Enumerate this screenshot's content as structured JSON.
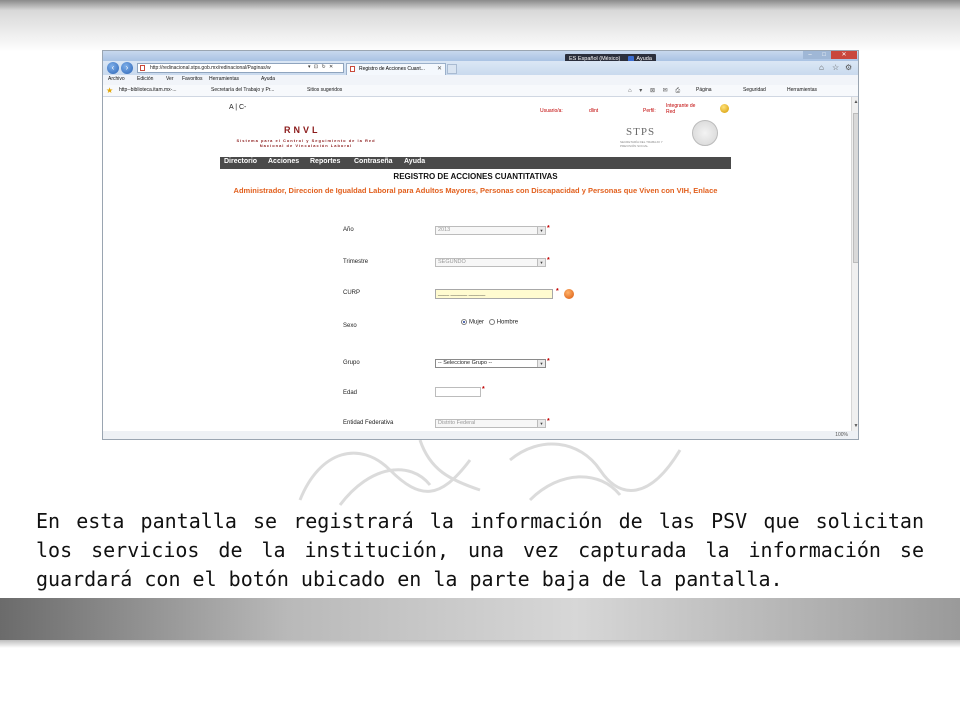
{
  "browser": {
    "url": "http://redinacional.stps.gob.mx/redinacional/Paginas/w",
    "tab_title": "Registro de Acciones Cuant...",
    "language_indicator": "ES Español (México)",
    "help_label": "Ayuda",
    "menu": [
      "Archivo",
      "Edición",
      "Ver",
      "Favoritos",
      "Herramientas",
      "Ayuda"
    ],
    "favorites": [
      "http--biblioteca.itam.mx-...",
      "Secretaría del Trabajo y Pr...",
      "Sitios sugeridos"
    ],
    "toolbar": [
      "Página",
      "Seguridad",
      "Herramientas"
    ]
  },
  "app": {
    "font_size_controls": "A | C-",
    "name": "RNVL",
    "subtitle": "Sistema para el Control y Seguimiento de la Red Nacional de Vinculación Laboral",
    "user_label": "Usuario/a:",
    "user_name": "dlint",
    "profile_label": "Perfil:",
    "profile_value": "Integrante de Red",
    "agency": "STPS",
    "agency_sub": "SECRETARÍA DEL TRABAJO Y PREVISIÓN SOCIAL",
    "nav": [
      "Directorio",
      "Acciones",
      "Reportes",
      "Contraseña",
      "Ayuda"
    ]
  },
  "form": {
    "title": "REGISTRO DE ACCIONES CUANTITATIVAS",
    "subtitle": "Administrador, Direccion de Igualdad Laboral para Adultos Mayores, Personas con Discapacidad y Personas que Viven con VIH, Enlace",
    "fields": {
      "anio": {
        "label": "Año",
        "value": "2013"
      },
      "trimestre": {
        "label": "Trimestre",
        "value": "SEGUNDO"
      },
      "curp": {
        "label": "CURP",
        "value": "____ ______ ______"
      },
      "sexo": {
        "label": "Sexo",
        "options": [
          "Mujer",
          "Hombre"
        ],
        "selected": "Mujer"
      },
      "grupo": {
        "label": "Grupo",
        "value": "-- Seleccione Grupo --"
      },
      "edad": {
        "label": "Edad",
        "value": ""
      },
      "entidad": {
        "label": "Entidad Federativa",
        "value": "Distrito Federal"
      }
    },
    "required_mark": "*"
  },
  "status": {
    "zoom": "100%"
  },
  "caption": "En esta pantalla se registrará la información de las PSV que solicitan los servicios de la institución, una vez capturada la información  se guardará con el botón ubicado en la parte baja de la pantalla."
}
